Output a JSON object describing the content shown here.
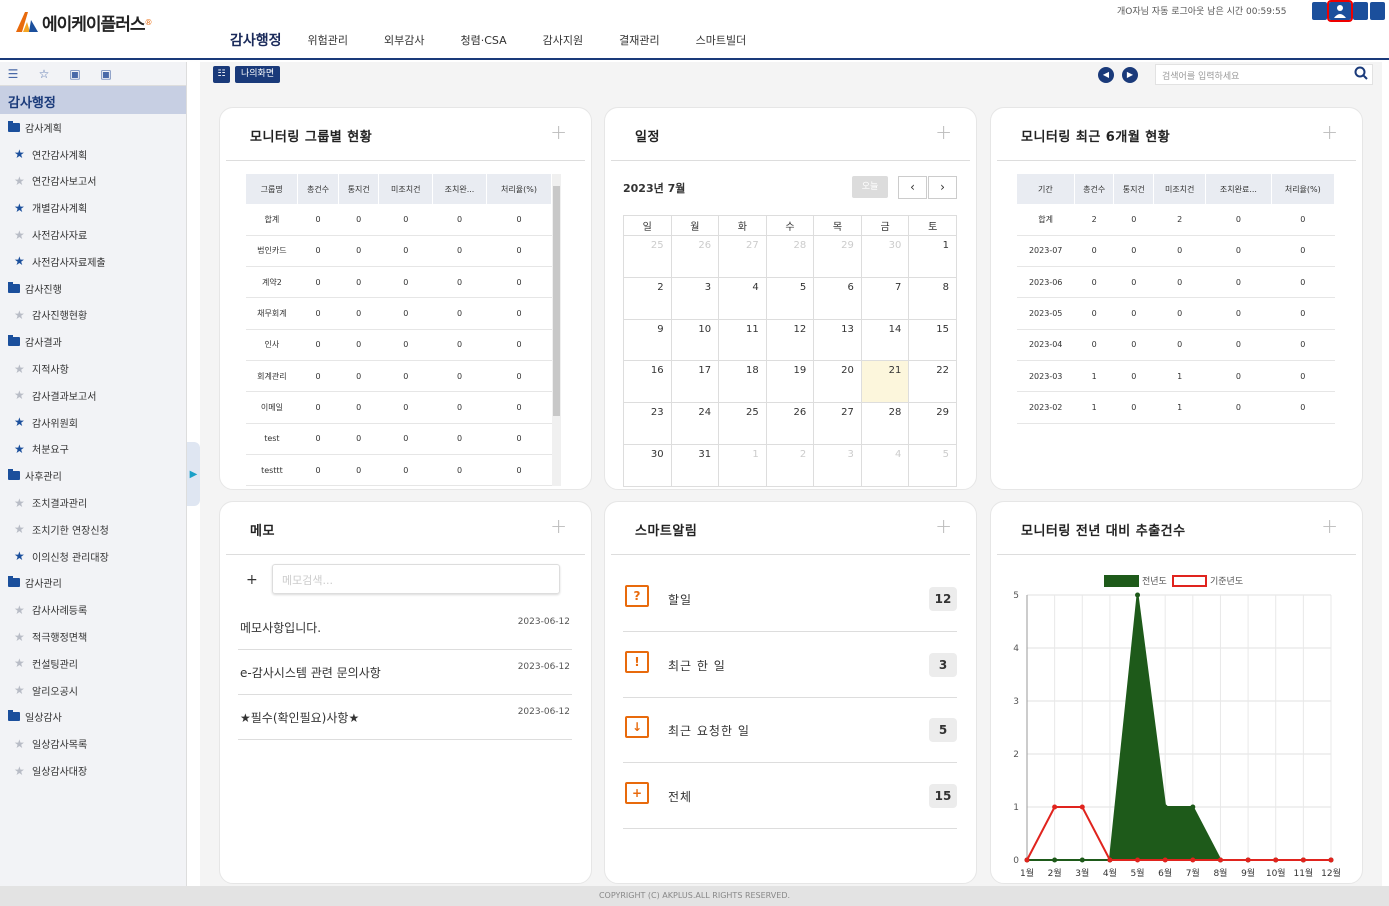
{
  "app": {
    "logo_text": "에이케이플러스",
    "logo_mark": "AK",
    "session_text": "개O자님 자동 로그아웃 남은 시간 00:59:55"
  },
  "topnav": [
    "감사행정",
    "위험관리",
    "외부감사",
    "청렴·CSA",
    "감사지원",
    "결재관리",
    "스마트빌더"
  ],
  "sidebar": {
    "title": "감사행정",
    "tree": [
      {
        "type": "folder",
        "label": "감사계획"
      },
      {
        "type": "leaf",
        "label": "연간감사계획",
        "star": true
      },
      {
        "type": "leaf",
        "label": "연간감사보고서",
        "star": false
      },
      {
        "type": "leaf",
        "label": "개별감사계획",
        "star": true
      },
      {
        "type": "leaf",
        "label": "사전감사자료",
        "star": false
      },
      {
        "type": "leaf",
        "label": "사전감사자료제출",
        "star": true
      },
      {
        "type": "folder",
        "label": "감사진행"
      },
      {
        "type": "leaf",
        "label": "감사진행현황",
        "star": false
      },
      {
        "type": "folder",
        "label": "감사결과"
      },
      {
        "type": "leaf",
        "label": "지적사항",
        "star": false
      },
      {
        "type": "leaf",
        "label": "감사결과보고서",
        "star": false
      },
      {
        "type": "leaf",
        "label": "감사위원회",
        "star": true
      },
      {
        "type": "leaf",
        "label": "처분요구",
        "star": true
      },
      {
        "type": "folder",
        "label": "사후관리"
      },
      {
        "type": "leaf",
        "label": "조치결과관리",
        "star": false
      },
      {
        "type": "leaf",
        "label": "조치기한 연장신청",
        "star": false
      },
      {
        "type": "leaf",
        "label": "이의신청 관리대장",
        "star": true
      },
      {
        "type": "folder",
        "label": "감사관리"
      },
      {
        "type": "leaf",
        "label": "감사사례등록",
        "star": false
      },
      {
        "type": "leaf",
        "label": "적극행정면책",
        "star": false
      },
      {
        "type": "leaf",
        "label": "컨설팅관리",
        "star": false
      },
      {
        "type": "leaf",
        "label": "알리오공시",
        "star": false
      },
      {
        "type": "folder",
        "label": "일상감사"
      },
      {
        "type": "leaf",
        "label": "일상감사목록",
        "star": false
      },
      {
        "type": "leaf",
        "label": "일상감사대장",
        "star": false
      }
    ]
  },
  "subbar": {
    "my_screen": "나의화면",
    "search_placeholder": "검색어를 입력하세요"
  },
  "group_status": {
    "title": "모니터링 그룹별 현황",
    "columns": [
      "그룹명",
      "총건수",
      "통지건",
      "미조치건",
      "조치완...",
      "처리율(%)"
    ],
    "rows": [
      [
        "합계",
        "0",
        "0",
        "0",
        "0",
        "0"
      ],
      [
        "법인카드",
        "0",
        "0",
        "0",
        "0",
        "0"
      ],
      [
        "계약2",
        "0",
        "0",
        "0",
        "0",
        "0"
      ],
      [
        "채무회계",
        "0",
        "0",
        "0",
        "0",
        "0"
      ],
      [
        "인사",
        "0",
        "0",
        "0",
        "0",
        "0"
      ],
      [
        "회계관리",
        "0",
        "0",
        "0",
        "0",
        "0"
      ],
      [
        "이메일",
        "0",
        "0",
        "0",
        "0",
        "0"
      ],
      [
        "test",
        "0",
        "0",
        "0",
        "0",
        "0"
      ],
      [
        "testtt",
        "0",
        "0",
        "0",
        "0",
        "0"
      ]
    ]
  },
  "schedule": {
    "title": "일정",
    "month": "2023년 7월",
    "today_label": "오늘",
    "prev": "‹",
    "next": "›",
    "weekdays": [
      "일",
      "월",
      "화",
      "수",
      "목",
      "금",
      "토"
    ],
    "weeks": [
      [
        [
          "25",
          1
        ],
        [
          "26",
          1
        ],
        [
          "27",
          1
        ],
        [
          "28",
          1
        ],
        [
          "29",
          1
        ],
        [
          "30",
          1
        ],
        [
          "1",
          0
        ]
      ],
      [
        [
          "2",
          0
        ],
        [
          "3",
          0
        ],
        [
          "4",
          0
        ],
        [
          "5",
          0
        ],
        [
          "6",
          0
        ],
        [
          "7",
          0
        ],
        [
          "8",
          0
        ]
      ],
      [
        [
          "9",
          0
        ],
        [
          "10",
          0
        ],
        [
          "11",
          0
        ],
        [
          "12",
          0
        ],
        [
          "13",
          0
        ],
        [
          "14",
          0
        ],
        [
          "15",
          0
        ]
      ],
      [
        [
          "16",
          0
        ],
        [
          "17",
          0
        ],
        [
          "18",
          0
        ],
        [
          "19",
          0
        ],
        [
          "20",
          0
        ],
        [
          "21",
          2
        ],
        [
          "22",
          0
        ]
      ],
      [
        [
          "23",
          0
        ],
        [
          "24",
          0
        ],
        [
          "25",
          0
        ],
        [
          "26",
          0
        ],
        [
          "27",
          0
        ],
        [
          "28",
          0
        ],
        [
          "29",
          0
        ]
      ],
      [
        [
          "30",
          0
        ],
        [
          "31",
          0
        ],
        [
          "1",
          1
        ],
        [
          "2",
          1
        ],
        [
          "3",
          1
        ],
        [
          "4",
          1
        ],
        [
          "5",
          1
        ]
      ]
    ]
  },
  "recent6": {
    "title": "모니터링 최근 6개월 현황",
    "columns": [
      "기간",
      "총건수",
      "통지건",
      "미조치건",
      "조치완료...",
      "처리율(%)"
    ],
    "rows": [
      [
        "합계",
        "2",
        "0",
        "2",
        "0",
        "0"
      ],
      [
        "2023-07",
        "0",
        "0",
        "0",
        "0",
        "0"
      ],
      [
        "2023-06",
        "0",
        "0",
        "0",
        "0",
        "0"
      ],
      [
        "2023-05",
        "0",
        "0",
        "0",
        "0",
        "0"
      ],
      [
        "2023-04",
        "0",
        "0",
        "0",
        "0",
        "0"
      ],
      [
        "2023-03",
        "1",
        "0",
        "1",
        "0",
        "0"
      ],
      [
        "2023-02",
        "1",
        "0",
        "1",
        "0",
        "0"
      ]
    ]
  },
  "memo": {
    "title": "메모",
    "add": "+",
    "search_placeholder": "메모검색...",
    "items": [
      {
        "text": "메모사항입니다.",
        "date": "2023-06-12"
      },
      {
        "text": "e-감사시스템 관련 문의사항",
        "date": "2023-06-12"
      },
      {
        "text": "★필수(확인필요)사항★",
        "date": "2023-06-12"
      }
    ]
  },
  "smart_alert": {
    "title": "스마트알림",
    "items": [
      {
        "label": "할일",
        "count": "12",
        "icon": "?"
      },
      {
        "label": "최근 한 일",
        "count": "3",
        "icon": "!"
      },
      {
        "label": "최근 요청한 일",
        "count": "5",
        "icon": "↓"
      },
      {
        "label": "전체",
        "count": "15",
        "icon": "+"
      }
    ]
  },
  "card_plus": "+",
  "chart_data": {
    "type": "line",
    "title": "모니터링 전년 대비 추출건수",
    "categories": [
      "1월",
      "2월",
      "3월",
      "4월",
      "5월",
      "6월",
      "7월",
      "8월",
      "9월",
      "10월",
      "11월",
      "12월"
    ],
    "series": [
      {
        "name": "전년도",
        "values": [
          0,
          0,
          0,
          0,
          5,
          1,
          1,
          0,
          0,
          0,
          0,
          0
        ],
        "color": "#1e5a1a",
        "fill": true
      },
      {
        "name": "기준년도",
        "values": [
          0,
          1,
          1,
          0,
          0,
          0,
          0,
          0,
          0,
          0,
          0,
          0
        ],
        "color": "#e0241e",
        "fill": false
      }
    ],
    "ylim": [
      0,
      5
    ],
    "yticks": [
      0,
      1,
      2,
      3,
      4,
      5
    ],
    "grid": true,
    "legend": "top"
  },
  "footer": "COPYRIGHT (C) AKPLUS.ALL RIGHTS RESERVED."
}
